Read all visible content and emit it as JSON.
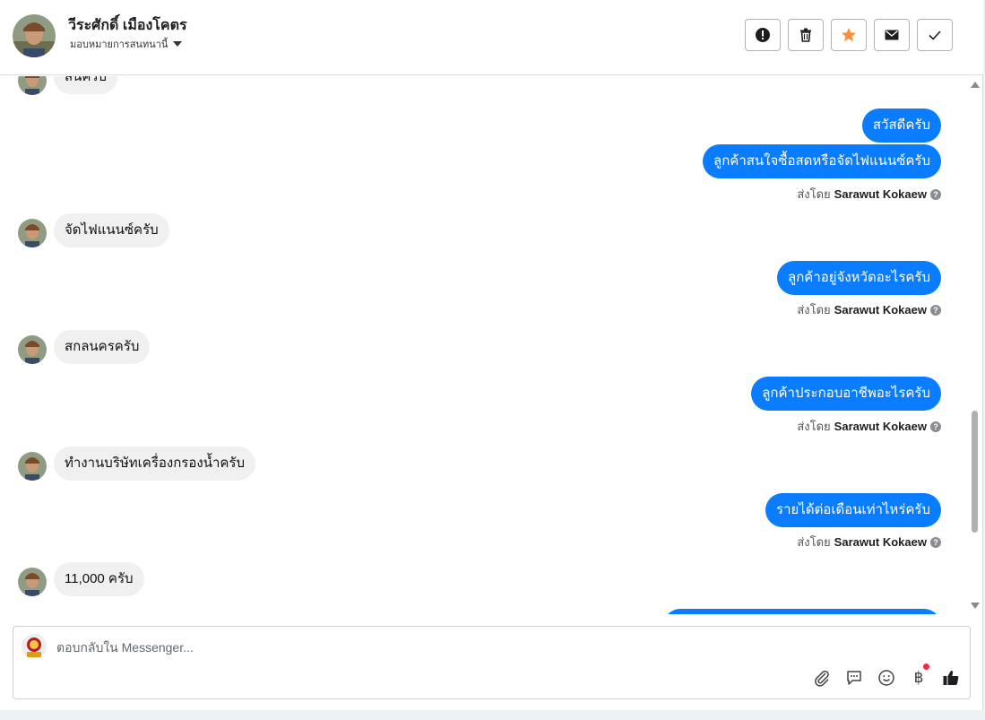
{
  "header": {
    "contact_name": "วีระศักดิ์ เมืองโคตร",
    "assign_label": "มอบหมายการสนทนานี้"
  },
  "toolbar": {
    "buttons": [
      "mark-spam",
      "delete",
      "star",
      "mark-unread",
      "done"
    ]
  },
  "messages": [
    {
      "side": "in",
      "text": "สนครับ",
      "avatar": true
    },
    {
      "side": "out",
      "text": "สวัสดีครับ"
    },
    {
      "side": "out",
      "text": "ลูกค้าสนใจซื้อสดหรือจัดไฟแนนซ์ครับ",
      "sent_prefix": "ส่งโดย",
      "sent_by": "Sarawut Kokaew"
    },
    {
      "side": "in",
      "text": "จัดไฟแนนซ์ครับ",
      "avatar": true
    },
    {
      "side": "out",
      "text": "ลูกค้าอยู่จังหวัดอะไรครับ",
      "sent_prefix": "ส่งโดย",
      "sent_by": "Sarawut Kokaew"
    },
    {
      "side": "in",
      "text": "สกลนครครับ",
      "avatar": true
    },
    {
      "side": "out",
      "text": "ลูกค้าประกอบอาชีพอะไรครับ",
      "sent_prefix": "ส่งโดย",
      "sent_by": "Sarawut Kokaew"
    },
    {
      "side": "in",
      "text": "ทำงานบริษัทเครื่องกรองน้ำครับ",
      "avatar": true
    },
    {
      "side": "out",
      "text": "รายได้ต่อเดือนเท่าไหร่ครับ",
      "sent_prefix": "ส่งโดย",
      "sent_by": "Sarawut Kokaew"
    },
    {
      "side": "in",
      "text": "11,000 ครับ",
      "avatar": true
    }
  ],
  "composer": {
    "placeholder": "ตอบกลับใน Messenger...",
    "icons": [
      "attachment-icon",
      "saved-reply-icon",
      "emoji-icon",
      "payment-icon",
      "like-icon"
    ],
    "payment_symbol": "฿"
  },
  "colors": {
    "outgoing_bubble": "#0a7cff",
    "incoming_bubble": "#f0f0f0",
    "star": "#f7923a",
    "notification_dot": "#f02849"
  }
}
